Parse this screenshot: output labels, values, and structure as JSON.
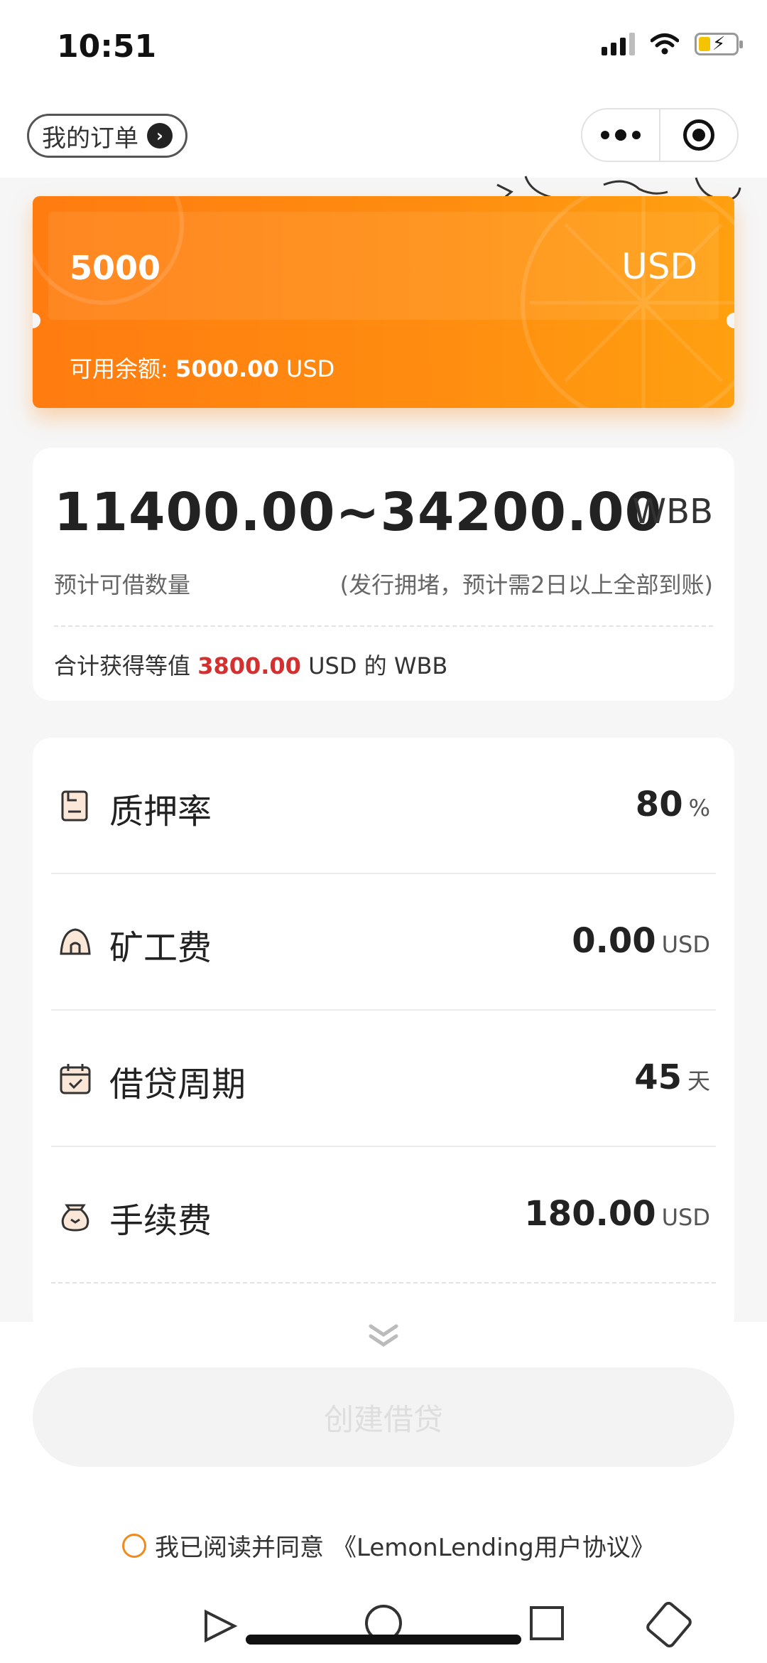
{
  "status_bar": {
    "time": "10:51"
  },
  "nav": {
    "orders_label": "我的订单"
  },
  "amount": {
    "value": "5000",
    "unit": "USD",
    "balance_label": "可用余额:",
    "balance_value": "5000.00",
    "balance_unit": "USD"
  },
  "estimate": {
    "range": "11400.00~34200.00",
    "unit": "WBB",
    "label": "预计可借数量",
    "note": "(发行拥堵，预计需2日以上全部到账)",
    "total_prefix": "合计获得等值",
    "total_value": "3800.00",
    "total_suffix": "USD 的 WBB"
  },
  "details": [
    {
      "label": "质押率",
      "value": "80",
      "unit": "%",
      "icon": "document-icon"
    },
    {
      "label": "矿工费",
      "value": "0.00",
      "unit": "USD",
      "icon": "mine-icon"
    },
    {
      "label": "借贷周期",
      "value": "45",
      "unit": "天",
      "icon": "calendar-icon"
    },
    {
      "label": "手续费",
      "value": "180.00",
      "unit": "USD",
      "icon": "money-bag-icon"
    }
  ],
  "create_button": "创建借贷",
  "agreement": {
    "text": "我已阅读并同意",
    "link": "《LemonLending用户协议》"
  },
  "colors": {
    "accent": "#ff8a10",
    "highlight": "#d43030"
  }
}
